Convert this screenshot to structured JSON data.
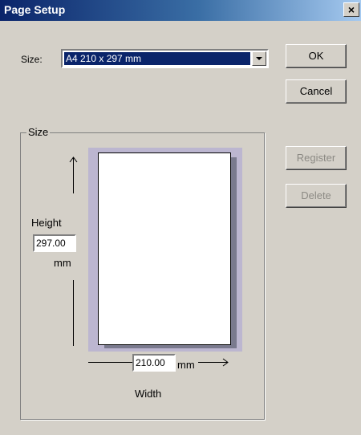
{
  "window": {
    "title": "Page Setup",
    "close_glyph": "×"
  },
  "size_field": {
    "label": "Size:",
    "value": "A4 210 x 297 mm"
  },
  "buttons": {
    "ok": "OK",
    "cancel": "Cancel",
    "register": "Register",
    "delete": "Delete"
  },
  "group": {
    "title": "Size",
    "height_label": "Height",
    "height_value": "297.00",
    "height_unit": "mm",
    "width_value": "210.00",
    "width_unit": "mm",
    "width_label": "Width"
  },
  "colors": {
    "titlebar_start": "#0a246a",
    "selection": "#0a246a",
    "dialog_bg": "#d4d0c8",
    "preview_bg": "#bcb6d0"
  }
}
